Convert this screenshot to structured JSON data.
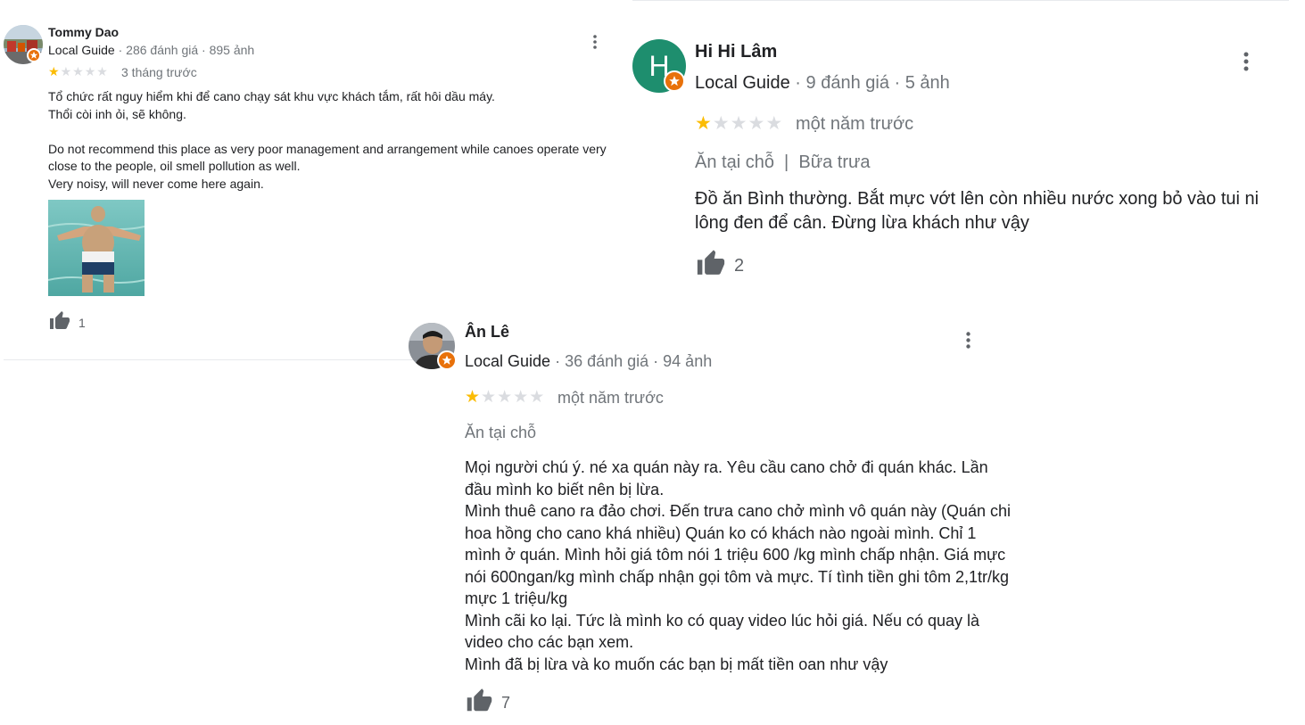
{
  "reviews": [
    {
      "reviewer_name": "Tommy Dao",
      "guide_label": "Local Guide",
      "stats": " · 286 đánh giá · 895 ảnh",
      "rating": 1,
      "rating_max": 5,
      "time": "3 tháng trước",
      "paragraphs": [
        "Tổ chức rất nguy hiểm khi để cano chạy sát khu vực khách tắm, rất hôi dầu máy.",
        "Thổi còi inh ỏi, sẽ không.",
        "",
        "Do not recommend this place as very poor management and arrangement while canoes operate very close to the people, oil smell pollution as well.",
        "Very noisy, will never come here again."
      ],
      "likes": "1"
    },
    {
      "reviewer_name": "Hi Hi Lâm",
      "guide_label": "Local Guide",
      "stats": " · 9 đánh giá · 5 ảnh",
      "rating": 1,
      "rating_max": 5,
      "time": "một năm trước",
      "tags": "Ăn tại chỗ  |  Bữa trưa",
      "paragraphs": [
        "Đồ ăn Bình thường. Bắt mực vớt lên còn nhiều nước xong bỏ vào tui ni lông đen để cân. Đừng lừa khách như vậy"
      ],
      "likes": "2",
      "avatar_letter": "H"
    },
    {
      "reviewer_name": "Ân Lê",
      "guide_label": "Local Guide",
      "stats": " · 36 đánh giá · 94 ảnh",
      "rating": 1,
      "rating_max": 5,
      "time": "một năm trước",
      "tags": "Ăn tại chỗ",
      "paragraphs": [
        "Mọi người chú ý. né xa quán này ra. Yêu cầu cano chở đi quán khác. Lần đầu mình ko biết nên bị lừa.",
        "Mình thuê cano ra đảo chơi. Đến trưa cano chở mình vô quán này (Quán chi hoa hồng cho cano khá nhiều) Quán ko có khách nào ngoài mình. Chỉ 1 mình ở quán. Mình hỏi giá tôm nói 1 triệu 600 /kg mình chấp nhận. Giá mực nói 600ngan/kg mình chấp nhận gọi tôm và mực. Tí tình tiền ghi tôm 2,1tr/kg mực 1 triệu/kg",
        "Mình cãi ko lại. Tức là mình ko có quay video lúc hỏi giá. Nếu có quay là video cho các bạn xem.",
        "Mình đã bị lừa và ko muốn các bạn bị mất tiền oan như vậy"
      ],
      "likes": "7"
    }
  ],
  "icons": {
    "like": "thumb-up-icon",
    "more": "more-vert-icon",
    "guide_badge": "local-guide-star-icon"
  },
  "colors": {
    "star_on": "#fbbc04",
    "star_off": "#dadce0",
    "badge": "#e8710a",
    "avatar_green": "#1e8e6e",
    "meta_text": "#70757a",
    "icon_gray": "#5f6368"
  }
}
